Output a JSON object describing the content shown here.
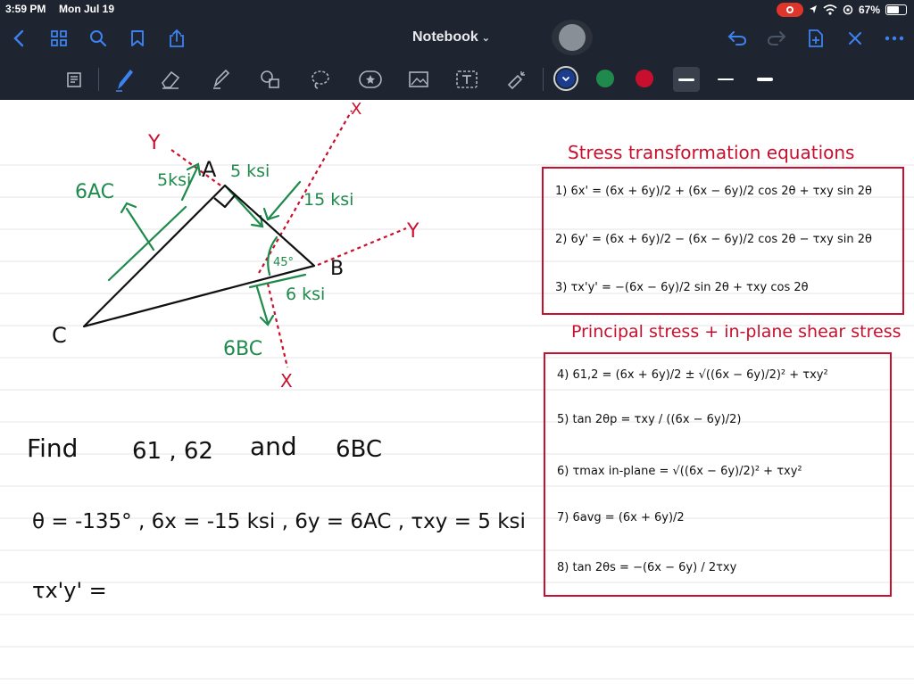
{
  "status": {
    "time": "3:59 PM",
    "date": "Mon Jul 19",
    "battery": "67%",
    "battery_level": 0.67
  },
  "app": {
    "title": "Notebook",
    "accent": "#3c82f0"
  },
  "colors": {
    "green": "#1f8a4c",
    "red": "#c8102e",
    "blue": "#1c3d8f",
    "black": "#111111",
    "rule": "#e4e4ea"
  },
  "diagram": {
    "label_y_left": "Y",
    "label_y_right": "Y",
    "label_x_top": "X",
    "label_x_bottom": "X",
    "label_A": "A",
    "label_B": "B",
    "label_C": "C",
    "sigma_ac": "6AC",
    "five_ksi_left": "5ksi",
    "five_ksi_right": "5 ksi",
    "fifteen_ksi": "15 ksi",
    "angle_45": "45°",
    "six_ksi": "6 ksi",
    "sigma_bc": "6BC"
  },
  "problem": {
    "find": "Find",
    "find_vars": "61 , 62",
    "and": "and",
    "find_bc": "6BC",
    "givens": "θ = -135° , 6x = -15 ksi , 6y = 6AC , τxy = 5 ksi",
    "txy_prime": "τx'y' ="
  },
  "box1": {
    "title": "Stress transformation equations",
    "eq1": "1)  6x' =  (6x + 6y)/2  +  (6x − 6y)/2 cos 2θ + τxy sin 2θ",
    "eq2": "2)  6y' =  (6x + 6y)/2  −  (6x − 6y)/2 cos 2θ − τxy sin 2θ",
    "eq3": "3)  τx'y' =  −(6x − 6y)/2 sin 2θ  +  τxy cos 2θ"
  },
  "box2": {
    "title": "Principal stress + in-plane shear stress",
    "eq4": "4)  61,2 =  (6x + 6y)/2 ± √((6x − 6y)/2)² + τxy²",
    "eq5": "5)  tan 2θp =  τxy / ((6x − 6y)/2)",
    "eq6": "6)  τmax in-plane =  √((6x − 6y)/2)² + τxy²",
    "eq7": "7)  6avg =  (6x + 6y)/2",
    "eq8": "8)  tan 2θs =  −(6x − 6y) / 2τxy"
  }
}
